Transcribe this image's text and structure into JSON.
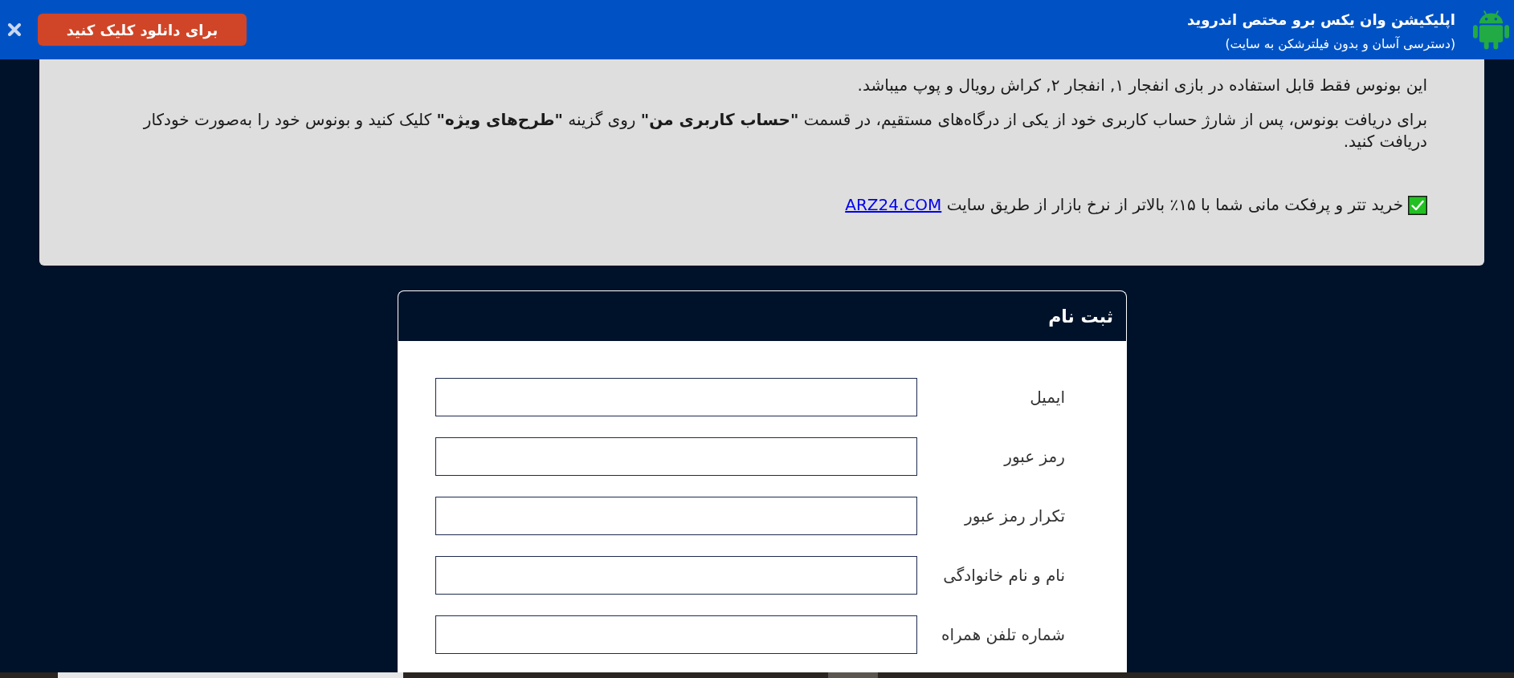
{
  "banner": {
    "title": "اپلیکیشن وان یکس برو مختص اندروید",
    "subtitle": "(دسترسی آسان و بدون فیلترشکن به سایت)",
    "download_button": "برای دانلود کلیک کنید"
  },
  "notice": {
    "paragraphs": [
      "این بونوس فقط قابل استفاده در بازی انفجار ۱, انفجار ۲, کراش رویال و پوپ میباشد.",
      "برای دریافت بونوس، پس از شارژ حساب کاربری خود از یکی از درگاه‌های مستقیم، در قسمت **\"حساب کاربری من\"** روی گزینه **\"طرح‌های ویژه\"** کلیک کنید و بونوس خود را به‌صورت خودکار دریافت کنید."
    ],
    "promo": {
      "text": "خرید تتر و پرفکت مانی شما با ۱۵٪ بالاتر از نرخ بازار از طریق سایت",
      "link": "ARZ24.COM"
    }
  },
  "register_form": {
    "title": "ثبت نام",
    "fields": [
      {
        "label": "ایمیل"
      },
      {
        "label": "رمز عبور"
      },
      {
        "label": "تکرار رمز عبور"
      },
      {
        "label": "نام و نام خانوادگی"
      },
      {
        "label": "شماره تلفن همراه"
      }
    ]
  }
}
